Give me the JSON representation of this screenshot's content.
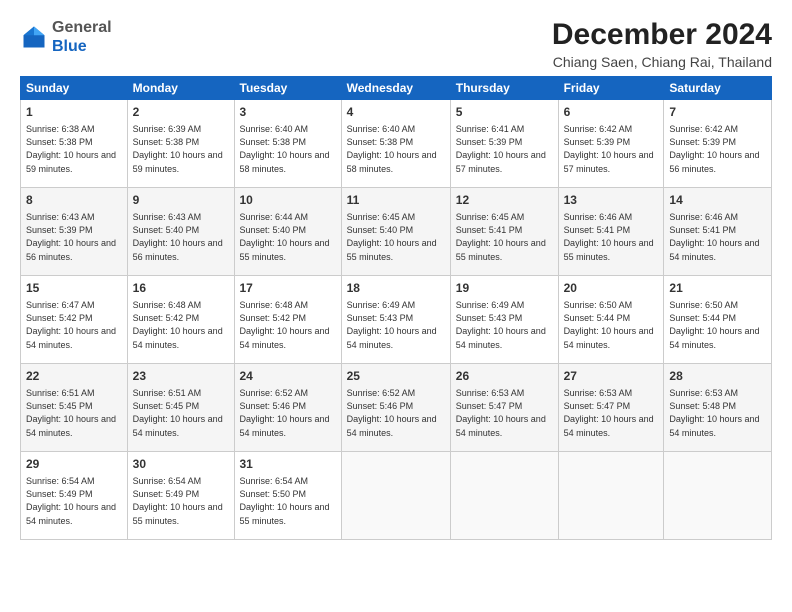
{
  "logo": {
    "general": "General",
    "blue": "Blue"
  },
  "header": {
    "month": "December 2024",
    "location": "Chiang Saen, Chiang Rai, Thailand"
  },
  "weekdays": [
    "Sunday",
    "Monday",
    "Tuesday",
    "Wednesday",
    "Thursday",
    "Friday",
    "Saturday"
  ],
  "weeks": [
    [
      {
        "day": 1,
        "sunrise": "6:38 AM",
        "sunset": "5:38 PM",
        "daylight": "10 hours and 59 minutes."
      },
      {
        "day": 2,
        "sunrise": "6:39 AM",
        "sunset": "5:38 PM",
        "daylight": "10 hours and 59 minutes."
      },
      {
        "day": 3,
        "sunrise": "6:40 AM",
        "sunset": "5:38 PM",
        "daylight": "10 hours and 58 minutes."
      },
      {
        "day": 4,
        "sunrise": "6:40 AM",
        "sunset": "5:38 PM",
        "daylight": "10 hours and 58 minutes."
      },
      {
        "day": 5,
        "sunrise": "6:41 AM",
        "sunset": "5:39 PM",
        "daylight": "10 hours and 57 minutes."
      },
      {
        "day": 6,
        "sunrise": "6:42 AM",
        "sunset": "5:39 PM",
        "daylight": "10 hours and 57 minutes."
      },
      {
        "day": 7,
        "sunrise": "6:42 AM",
        "sunset": "5:39 PM",
        "daylight": "10 hours and 56 minutes."
      }
    ],
    [
      {
        "day": 8,
        "sunrise": "6:43 AM",
        "sunset": "5:39 PM",
        "daylight": "10 hours and 56 minutes."
      },
      {
        "day": 9,
        "sunrise": "6:43 AM",
        "sunset": "5:40 PM",
        "daylight": "10 hours and 56 minutes."
      },
      {
        "day": 10,
        "sunrise": "6:44 AM",
        "sunset": "5:40 PM",
        "daylight": "10 hours and 55 minutes."
      },
      {
        "day": 11,
        "sunrise": "6:45 AM",
        "sunset": "5:40 PM",
        "daylight": "10 hours and 55 minutes."
      },
      {
        "day": 12,
        "sunrise": "6:45 AM",
        "sunset": "5:41 PM",
        "daylight": "10 hours and 55 minutes."
      },
      {
        "day": 13,
        "sunrise": "6:46 AM",
        "sunset": "5:41 PM",
        "daylight": "10 hours and 55 minutes."
      },
      {
        "day": 14,
        "sunrise": "6:46 AM",
        "sunset": "5:41 PM",
        "daylight": "10 hours and 54 minutes."
      }
    ],
    [
      {
        "day": 15,
        "sunrise": "6:47 AM",
        "sunset": "5:42 PM",
        "daylight": "10 hours and 54 minutes."
      },
      {
        "day": 16,
        "sunrise": "6:48 AM",
        "sunset": "5:42 PM",
        "daylight": "10 hours and 54 minutes."
      },
      {
        "day": 17,
        "sunrise": "6:48 AM",
        "sunset": "5:42 PM",
        "daylight": "10 hours and 54 minutes."
      },
      {
        "day": 18,
        "sunrise": "6:49 AM",
        "sunset": "5:43 PM",
        "daylight": "10 hours and 54 minutes."
      },
      {
        "day": 19,
        "sunrise": "6:49 AM",
        "sunset": "5:43 PM",
        "daylight": "10 hours and 54 minutes."
      },
      {
        "day": 20,
        "sunrise": "6:50 AM",
        "sunset": "5:44 PM",
        "daylight": "10 hours and 54 minutes."
      },
      {
        "day": 21,
        "sunrise": "6:50 AM",
        "sunset": "5:44 PM",
        "daylight": "10 hours and 54 minutes."
      }
    ],
    [
      {
        "day": 22,
        "sunrise": "6:51 AM",
        "sunset": "5:45 PM",
        "daylight": "10 hours and 54 minutes."
      },
      {
        "day": 23,
        "sunrise": "6:51 AM",
        "sunset": "5:45 PM",
        "daylight": "10 hours and 54 minutes."
      },
      {
        "day": 24,
        "sunrise": "6:52 AM",
        "sunset": "5:46 PM",
        "daylight": "10 hours and 54 minutes."
      },
      {
        "day": 25,
        "sunrise": "6:52 AM",
        "sunset": "5:46 PM",
        "daylight": "10 hours and 54 minutes."
      },
      {
        "day": 26,
        "sunrise": "6:53 AM",
        "sunset": "5:47 PM",
        "daylight": "10 hours and 54 minutes."
      },
      {
        "day": 27,
        "sunrise": "6:53 AM",
        "sunset": "5:47 PM",
        "daylight": "10 hours and 54 minutes."
      },
      {
        "day": 28,
        "sunrise": "6:53 AM",
        "sunset": "5:48 PM",
        "daylight": "10 hours and 54 minutes."
      }
    ],
    [
      {
        "day": 29,
        "sunrise": "6:54 AM",
        "sunset": "5:49 PM",
        "daylight": "10 hours and 54 minutes."
      },
      {
        "day": 30,
        "sunrise": "6:54 AM",
        "sunset": "5:49 PM",
        "daylight": "10 hours and 55 minutes."
      },
      {
        "day": 31,
        "sunrise": "6:54 AM",
        "sunset": "5:50 PM",
        "daylight": "10 hours and 55 minutes."
      },
      null,
      null,
      null,
      null
    ]
  ]
}
